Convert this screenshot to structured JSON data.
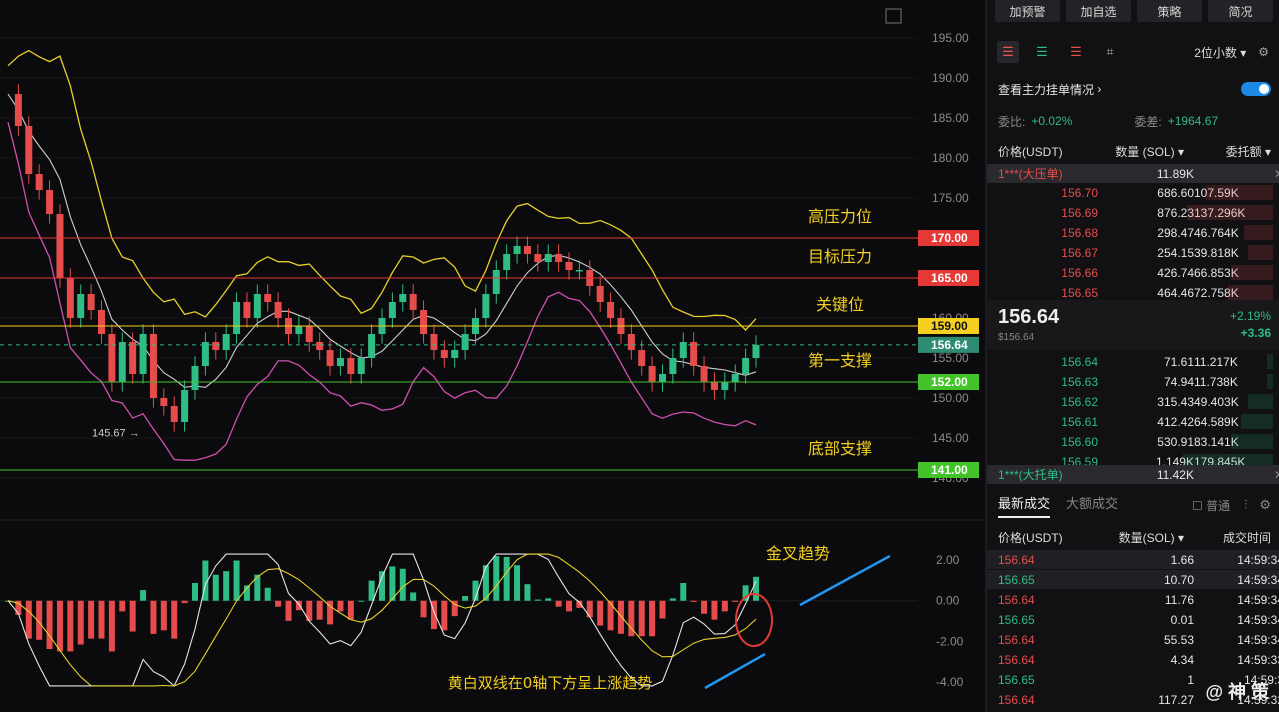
{
  "chart_data": {
    "type": "line",
    "price_axis": {
      "min": 137,
      "max": 197,
      "ticks": [
        "195.00",
        "190.00",
        "185.00",
        "180.00",
        "175.00",
        "170.00",
        "165.00",
        "160.00",
        "155.00",
        "150.00",
        "145.00",
        "140.00"
      ]
    },
    "macd_axis": {
      "min": -4.4,
      "max": 2.6,
      "ticks": [
        "2.00",
        "0.00",
        "-2.00",
        "-4.00"
      ]
    },
    "levels": [
      {
        "value": 170,
        "tag": "170.00",
        "label": "高压力位",
        "color": "#e53935"
      },
      {
        "value": 165,
        "tag": "165.00",
        "label": "目标压力",
        "color": "#e53935"
      },
      {
        "value": 159,
        "tag": "159.00",
        "label": "关键位",
        "color": "#f5d020"
      },
      {
        "value": 152,
        "tag": "152.00",
        "label": "第一支撑",
        "color": "#43c22a"
      },
      {
        "value": 141,
        "tag": "141.00",
        "label": "底部支撑",
        "color": "#43c22a"
      }
    ],
    "current_price": {
      "value": 156.64,
      "tag": "156.64",
      "color": "#2e8b74"
    },
    "low_annotation": {
      "value": 145.67,
      "text": "145.67 →"
    },
    "price_series": [
      188,
      184,
      178,
      176,
      173,
      165,
      160,
      163,
      161,
      158,
      152,
      157,
      153,
      158,
      150,
      149,
      147,
      151,
      154,
      157,
      156,
      158,
      162,
      160,
      163,
      162,
      160,
      158,
      159,
      157,
      156,
      154,
      155,
      153,
      155,
      158,
      160,
      162,
      163,
      161,
      158,
      156,
      155,
      156,
      158,
      160,
      163,
      166,
      168,
      169,
      168,
      167,
      168,
      167,
      166,
      166,
      164,
      162,
      160,
      158,
      156,
      154,
      152,
      153,
      155,
      157,
      154,
      152,
      151,
      152,
      153,
      155,
      156.64
    ],
    "annotations": {
      "golden_cross": "金叉趋势",
      "macd_note": "黄白双线在0轴下方呈上涨趋势"
    },
    "colors": {
      "bb_upper": "#e6d02a",
      "bb_mid": "#cfcfcf",
      "bb_lower": "#d04fb0",
      "up": "#2ebd85",
      "down": "#e64c4c"
    }
  },
  "panel": {
    "buttons": [
      "加预警",
      "加自选",
      "策略",
      "简况"
    ],
    "decimals": "2位小数",
    "main_order_label": "查看主力挂单情况",
    "entrust_ratio_label": "委比:",
    "entrust_ratio_value": "+0.02%",
    "entrust_diff_label": "委差:",
    "entrust_diff_value": "+1964.67",
    "col_price": "价格(USDT)",
    "col_qty": "数量 (SOL)",
    "col_amount": "委托额",
    "big_ask_label": "1***(大压单)",
    "big_ask_qty": "11.89K",
    "asks": [
      {
        "price": "156.70",
        "qty": "686.60",
        "amount": "107.59K"
      },
      {
        "price": "156.69",
        "qty": "876.23",
        "amount": "137.296K"
      },
      {
        "price": "156.68",
        "qty": "298.47",
        "amount": "46.764K"
      },
      {
        "price": "156.67",
        "qty": "254.15",
        "amount": "39.818K"
      },
      {
        "price": "156.66",
        "qty": "426.74",
        "amount": "66.853K"
      },
      {
        "price": "156.65",
        "qty": "464.46",
        "amount": "72.758K"
      }
    ],
    "last_price": "156.64",
    "last_price_sub": "$156.64",
    "change_pct": "+2.19%",
    "change_abs": "+3.36",
    "bids": [
      {
        "price": "156.64",
        "qty": "71.61",
        "amount": "11.217K"
      },
      {
        "price": "156.63",
        "qty": "74.94",
        "amount": "11.738K"
      },
      {
        "price": "156.62",
        "qty": "315.43",
        "amount": "49.403K"
      },
      {
        "price": "156.61",
        "qty": "412.42",
        "amount": "64.589K"
      },
      {
        "price": "156.60",
        "qty": "530.91",
        "amount": "83.141K"
      },
      {
        "price": "156.59",
        "qty": "1.149K",
        "amount": "179.845K"
      }
    ],
    "big_bid_label": "1***(大托单)",
    "big_bid_qty": "11.42K",
    "tab_latest": "最新成交",
    "tab_large": "大额成交",
    "normal_label": "普通",
    "trade_col_price": "价格(USDT)",
    "trade_col_qty": "数量(SOL)",
    "trade_col_time": "成交时间",
    "trades": [
      {
        "price": "156.64",
        "qty": "1.66",
        "time": "14:59:34",
        "side": "red"
      },
      {
        "price": "156.65",
        "qty": "10.70",
        "time": "14:59:34",
        "side": "green"
      },
      {
        "price": "156.64",
        "qty": "11.76",
        "time": "14:59:34",
        "side": "red"
      },
      {
        "price": "156.65",
        "qty": "0.01",
        "time": "14:59:34",
        "side": "green"
      },
      {
        "price": "156.64",
        "qty": "55.53",
        "time": "14:59:34",
        "side": "red"
      },
      {
        "price": "156.64",
        "qty": "4.34",
        "time": "14:59:33",
        "side": "red"
      },
      {
        "price": "156.65",
        "qty": "1",
        "time": "14:59:3",
        "side": "green"
      },
      {
        "price": "156.64",
        "qty": "117.27",
        "time": "14:59:32",
        "side": "red"
      }
    ],
    "watermark": "@ 神 策"
  }
}
